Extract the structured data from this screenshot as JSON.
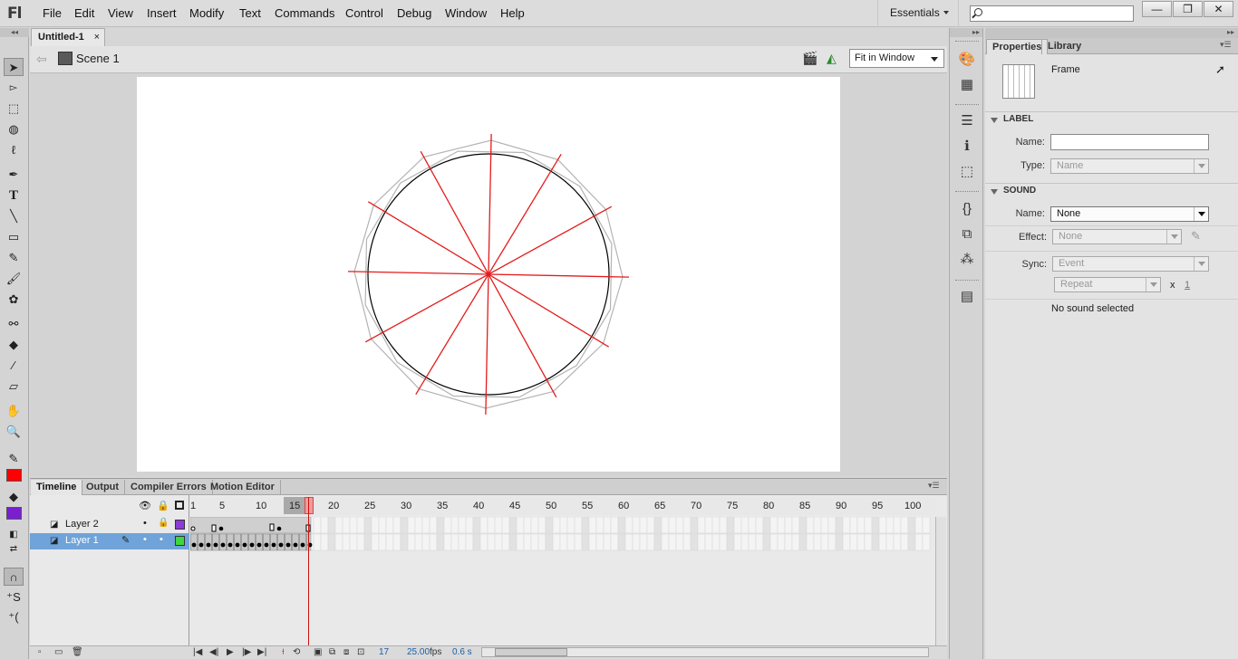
{
  "menubar": {
    "logo": "Fl",
    "items": [
      "File",
      "Edit",
      "View",
      "Insert",
      "Modify",
      "Text",
      "Commands",
      "Control",
      "Debug",
      "Window",
      "Help"
    ],
    "workspace": "Essentials",
    "search_placeholder": ""
  },
  "window_controls": {
    "minimize": "—",
    "restore": "❐",
    "close": "✕"
  },
  "document": {
    "tab": "Untitled-1",
    "close": "×",
    "scene": "Scene 1",
    "zoom": "Fit in Window"
  },
  "tools": {
    "icons": [
      "selection-tool",
      "subselection-tool",
      "free-transform-tool",
      "3d-rotation-tool",
      "lasso-tool",
      "pen-tool",
      "text-tool",
      "line-tool",
      "rectangle-tool",
      "pencil-tool",
      "brush-tool",
      "deco-tool",
      "bone-tool",
      "paint-bucket-tool",
      "eyedropper-tool",
      "eraser-tool",
      "hand-tool",
      "zoom-tool"
    ],
    "stroke_color": "#ff0000",
    "fill_color": "#7a1fd0"
  },
  "timeline": {
    "tabs": [
      "Timeline",
      "Output",
      "Compiler Errors",
      "Motion Editor"
    ],
    "ruler": [
      "1",
      "5",
      "10",
      "15",
      "20",
      "25",
      "30",
      "35",
      "40",
      "45",
      "50",
      "55",
      "60",
      "65",
      "70",
      "75",
      "80",
      "85",
      "90",
      "95",
      "100"
    ],
    "current_frame_marker": "15",
    "layers": [
      {
        "name": "Layer 2",
        "color": "#8b3bd6",
        "selected": false
      },
      {
        "name": "Layer 1",
        "color": "#3fd63f",
        "selected": true
      }
    ],
    "current_frame": "17",
    "fps": "25.00",
    "fps_unit": "fps",
    "elapsed": "0.6 s"
  },
  "properties": {
    "tabs": [
      "Properties",
      "Library"
    ],
    "object_type": "Frame",
    "label_section": "LABEL",
    "name_label": "Name:",
    "name_value": "",
    "type_label": "Type:",
    "type_value": "Name",
    "sound_section": "SOUND",
    "sound_name_label": "Name:",
    "sound_name_value": "None",
    "effect_label": "Effect:",
    "effect_value": "None",
    "sync_label": "Sync:",
    "sync_value": "Event",
    "repeat_value": "Repeat",
    "repeat_x": "x",
    "repeat_count": "1",
    "no_sound": "No sound selected"
  },
  "stage_drawing": {
    "circle_color": "#000000",
    "spoke_color": "#e41b1b",
    "polygon_color": "#b4b4b4"
  }
}
